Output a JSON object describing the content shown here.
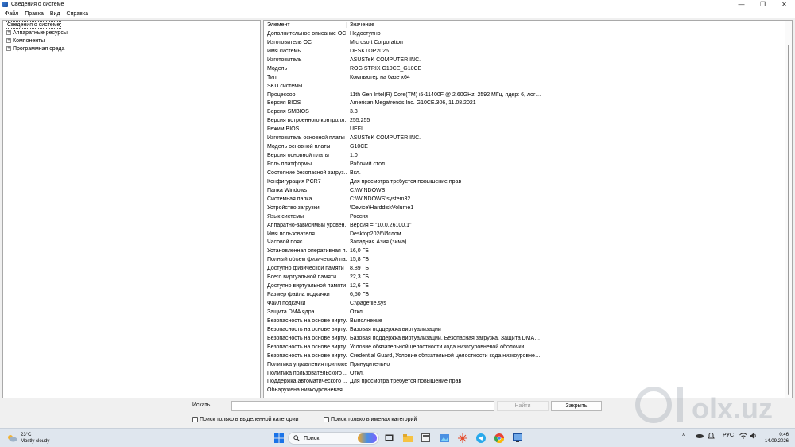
{
  "window": {
    "title": "Сведения о системе",
    "controls": [
      "minimize-icon",
      "maximize-icon",
      "close-icon"
    ]
  },
  "menu": [
    "Файл",
    "Правка",
    "Вид",
    "Справка"
  ],
  "tree": {
    "root": "Сведения о системе",
    "children": [
      "Аппаратные ресурсы",
      "Компоненты",
      "Программная среда"
    ]
  },
  "details": {
    "columns": [
      "Элемент",
      "Значение"
    ],
    "rows": [
      [
        "Дополнительное описание ОС",
        "Недоступно"
      ],
      [
        "Изготовитель ОС",
        "Microsoft Corporation"
      ],
      [
        "Имя системы",
        "DESKTOP2026"
      ],
      [
        "Изготовитель",
        "ASUSTeK COMPUTER INC."
      ],
      [
        "Модель",
        "ROG STRIX G10CE_G10CE"
      ],
      [
        "Тип",
        "Компьютер на базе x64"
      ],
      [
        "SKU системы",
        ""
      ],
      [
        "Процессор",
        "11th Gen Intel(R) Core(TM) i5-11400F @ 2.60GHz, 2592 МГц, ядер: 6, логичес..."
      ],
      [
        "Версия BIOS",
        "American Megatrends Inc. G10CE.306, 11.08.2021"
      ],
      [
        "Версия SMBIOS",
        "3.3"
      ],
      [
        "Версия встроенного контролл...",
        "255.255"
      ],
      [
        "Режим BIOS",
        "UEFI"
      ],
      [
        "Изготовитель основной платы",
        "ASUSTeK COMPUTER INC."
      ],
      [
        "Модель основной платы",
        "G10CE"
      ],
      [
        "Версия основной платы",
        "1.0"
      ],
      [
        "Роль платформы",
        "Рабочий стол"
      ],
      [
        "Состояние безопасной загруз...",
        "Вкл."
      ],
      [
        "Конфигурация PCR7",
        "Для просмотра требуется повышение прав"
      ],
      [
        "Папка Windows",
        "C:\\WINDOWS"
      ],
      [
        "Системная папка",
        "C:\\WINDOWS\\system32"
      ],
      [
        "Устройство загрузки",
        "\\Device\\HarddiskVolume1"
      ],
      [
        "Язык системы",
        "Россия"
      ],
      [
        "Аппаратно-зависимый уровен...",
        "Версия = \"10.0.26100.1\""
      ],
      [
        "Имя пользователя",
        "Desktop2026\\Ислом"
      ],
      [
        "Часовой пояс",
        "Западная Азия (зима)"
      ],
      [
        "Установленная оперативная п...",
        "16,0 ГБ"
      ],
      [
        "Полный объем физической па...",
        "15,8 ГБ"
      ],
      [
        "Доступно физической памяти",
        "8,89 ГБ"
      ],
      [
        "Всего виртуальной памяти",
        "22,3 ГБ"
      ],
      [
        "Доступно виртуальной памяти",
        "12,6 ГБ"
      ],
      [
        "Размер файла подкачки",
        "6,50 ГБ"
      ],
      [
        "Файл подкачки",
        "C:\\pagefile.sys"
      ],
      [
        "Защита DMA ядра",
        "Откл."
      ],
      [
        "Безопасность на основе вирту...",
        "Выполнение"
      ],
      [
        "Безопасность на основе вирту...",
        "Базовая поддержка виртуализации"
      ],
      [
        "Безопасность на основе вирту...",
        "Базовая поддержка виртуализации, Безопасная загрузка, Защита DMA, Кон..."
      ],
      [
        "Безопасность на основе вирту...",
        "Условие обязательной целостности кода низкоуровневой оболочки"
      ],
      [
        "Безопасность на основе вирту...",
        "Credential Guard, Условие обязательной целостности кода низкоуровнева..."
      ],
      [
        "Политика управления приложе...",
        "Принудительно"
      ],
      [
        "Политика пользовательского ...",
        "Откл."
      ],
      [
        "Поддержка автоматического ...",
        "Для просмотра требуется повышение прав"
      ],
      [
        "Обнаружена низкоуровневая ...",
        ""
      ]
    ]
  },
  "find": {
    "label": "Искать:",
    "value": "",
    "find_button": "Найти",
    "close_button": "Закрыть",
    "checkbox_selected_category": "Поиск только в выделенной категории",
    "checkbox_category_names": "Поиск только в именах категорий"
  },
  "taskbar": {
    "weather_temp": "23°C",
    "weather_desc": "Mostly cloudy",
    "search_placeholder": "Поиск",
    "language": "РУС",
    "time": "0:46",
    "date": "14.09.2026",
    "watermark": "olx.uz"
  },
  "colors": {
    "window_bg": "#f0f0f0",
    "taskbar_bg": "#dfe6ee",
    "start_blue": "#1a73e8",
    "telegram": "#29a9eb"
  }
}
